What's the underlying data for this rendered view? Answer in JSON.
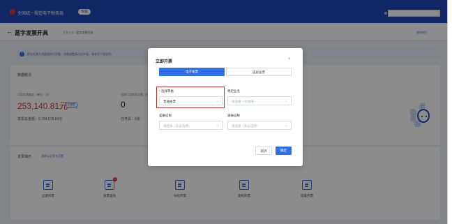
{
  "topbar": {
    "system_title": "全国统一规范电子税务局",
    "env_badge": "专属"
  },
  "subheader": {
    "page_title": "蓝字发票开具",
    "breadcrumb_parent": "发票业务",
    "breadcrumb_separator": "/",
    "breadcrumb_current": "蓝字发票开具",
    "guide_link": "操作指引"
  },
  "notice": {
    "text": "数电发票开具额度按月调整，如需调整请点击申请，请参考下图说明。"
  },
  "overview": {
    "title": "数据概况",
    "credit_label": "可用发票额度（单位：元）",
    "credit_value": "253,140.81元",
    "credit_tag": "去调整",
    "mid_label": "当期可用纸质发票（份）",
    "mid_value": "0",
    "issued_total_label": "发票总金额：",
    "issued_total_value": "9,784,078.64元",
    "issued_count_label": "已开具：",
    "issued_count_value": "0张",
    "dash": "-"
  },
  "invoice_fill": {
    "title": "发票填开",
    "link": "关联认证签名设置",
    "actions": [
      {
        "label": "立即开票",
        "icon": "invoice-icon"
      },
      {
        "label": "发票查询",
        "icon": "search-doc-icon",
        "badge": "7"
      },
      {
        "label": "扫码开票",
        "icon": "qr-icon"
      },
      {
        "label": "复制开票",
        "icon": "copy-icon"
      },
      {
        "label": "批量开票",
        "icon": "batch-icon"
      }
    ]
  },
  "mascot": {
    "chars": [
      "征",
      "纳",
      "互",
      "动"
    ]
  },
  "modal": {
    "title": "立即开票",
    "close_icon": "×",
    "tabs": [
      "电子发票",
      "纸质发票"
    ],
    "fields": {
      "invoice_type": {
        "label": "选择票类",
        "required": "*",
        "value": "普通发票"
      },
      "special_business": {
        "label": "特定业务",
        "placeholder": "请选择（可选填）"
      },
      "diff_tax": {
        "label": "差额征税",
        "placeholder": "请选择（非必选项）"
      },
      "reduced_tax": {
        "label": "减按征税",
        "placeholder": "请选择（非必选项）"
      }
    },
    "cancel_label": "取消",
    "ok_label": "确定"
  },
  "colors": {
    "brand_blue": "#1f48b8",
    "primary": "#2f6fe8",
    "danger": "#e0362d"
  }
}
